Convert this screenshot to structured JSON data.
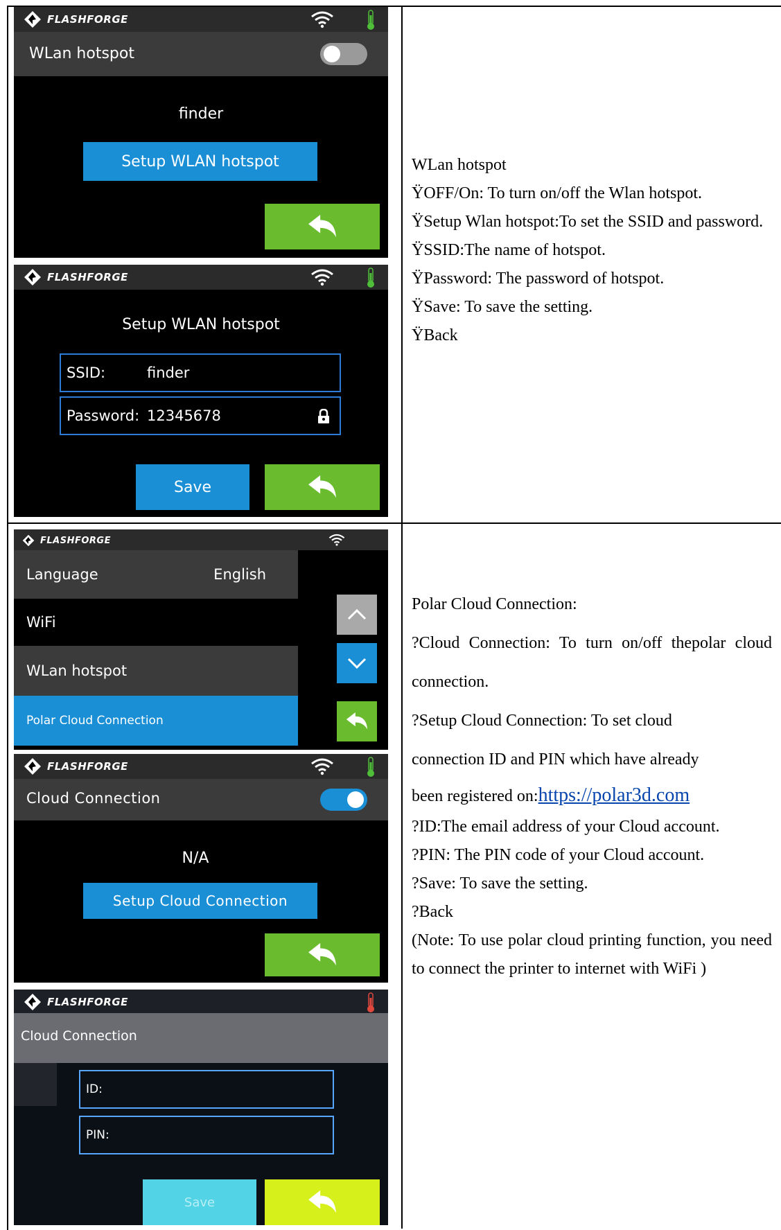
{
  "brand": "FLASHFORGE",
  "colors": {
    "accent_blue": "#1a8fd6",
    "back_green": "#6abb2e",
    "field_border": "#2c7bd4",
    "thermo_green": "#4fbf3a",
    "thermo_red": "#e0483e",
    "link": "#0645ad"
  },
  "icons": {
    "wifi": "wifi-icon",
    "thermometer": "thermometer-icon",
    "back": "back-arrow-icon",
    "lock": "lock-icon",
    "up": "chevron-up-icon",
    "down": "chevron-down-icon"
  },
  "screens": {
    "wlan_hotspot": {
      "title": "WLan hotspot",
      "toggle_on": false,
      "ssid_value": "finder",
      "setup_button": "Setup WLAN hotspot"
    },
    "setup_wlan": {
      "title": "Setup WLAN hotspot",
      "ssid_label": "SSID:",
      "ssid_value": "finder",
      "password_label": "Password:",
      "password_value": "12345678",
      "save_button": "Save"
    },
    "settings_menu": {
      "items": [
        {
          "label": "Language",
          "value": "English"
        },
        {
          "label": "WiFi",
          "value": ""
        },
        {
          "label": "WLan hotspot",
          "value": ""
        },
        {
          "label": "Polar Cloud Connection",
          "value": ""
        }
      ],
      "selected_index": 3
    },
    "cloud_connection": {
      "title": "Cloud Connection",
      "toggle_on": true,
      "status_value": "N/A",
      "setup_button": "Setup Cloud Connection"
    },
    "cloud_setup": {
      "title": "Cloud Connection",
      "id_label": "ID:",
      "pin_label": "PIN:",
      "save_button": "Save"
    }
  },
  "description_1": {
    "heading": "WLan hotspot",
    "items": [
      "ŸOFF/On: To turn on/off the Wlan hotspot.",
      "ŸSetup Wlan hotspot:To set the SSID and password.",
      "ŸSSID:The name of hotspot.",
      "ŸPassword: The password of hotspot.",
      "ŸSave: To save the setting.",
      "ŸBack"
    ]
  },
  "description_2": {
    "heading": "Polar Cloud Connection:",
    "item_cloud": "?Cloud Connection: To turn on/off thepolar cloud connection.",
    "item_setup_line1": "?Setup Cloud Connection: To set cloud",
    "item_setup_line2": "connection ID and PIN which have already",
    "item_setup_line3_prefix": "been registered on:",
    "link": "https://polar3d.com",
    "item_id": "?ID:The email address of your Cloud account.",
    "item_pin": "?PIN: The PIN code of your Cloud account.",
    "item_save": "?Save: To save the setting.",
    "item_back": "?Back",
    "note": "(Note: To use polar cloud printing function, you need to connect the printer to internet with WiFi )"
  }
}
